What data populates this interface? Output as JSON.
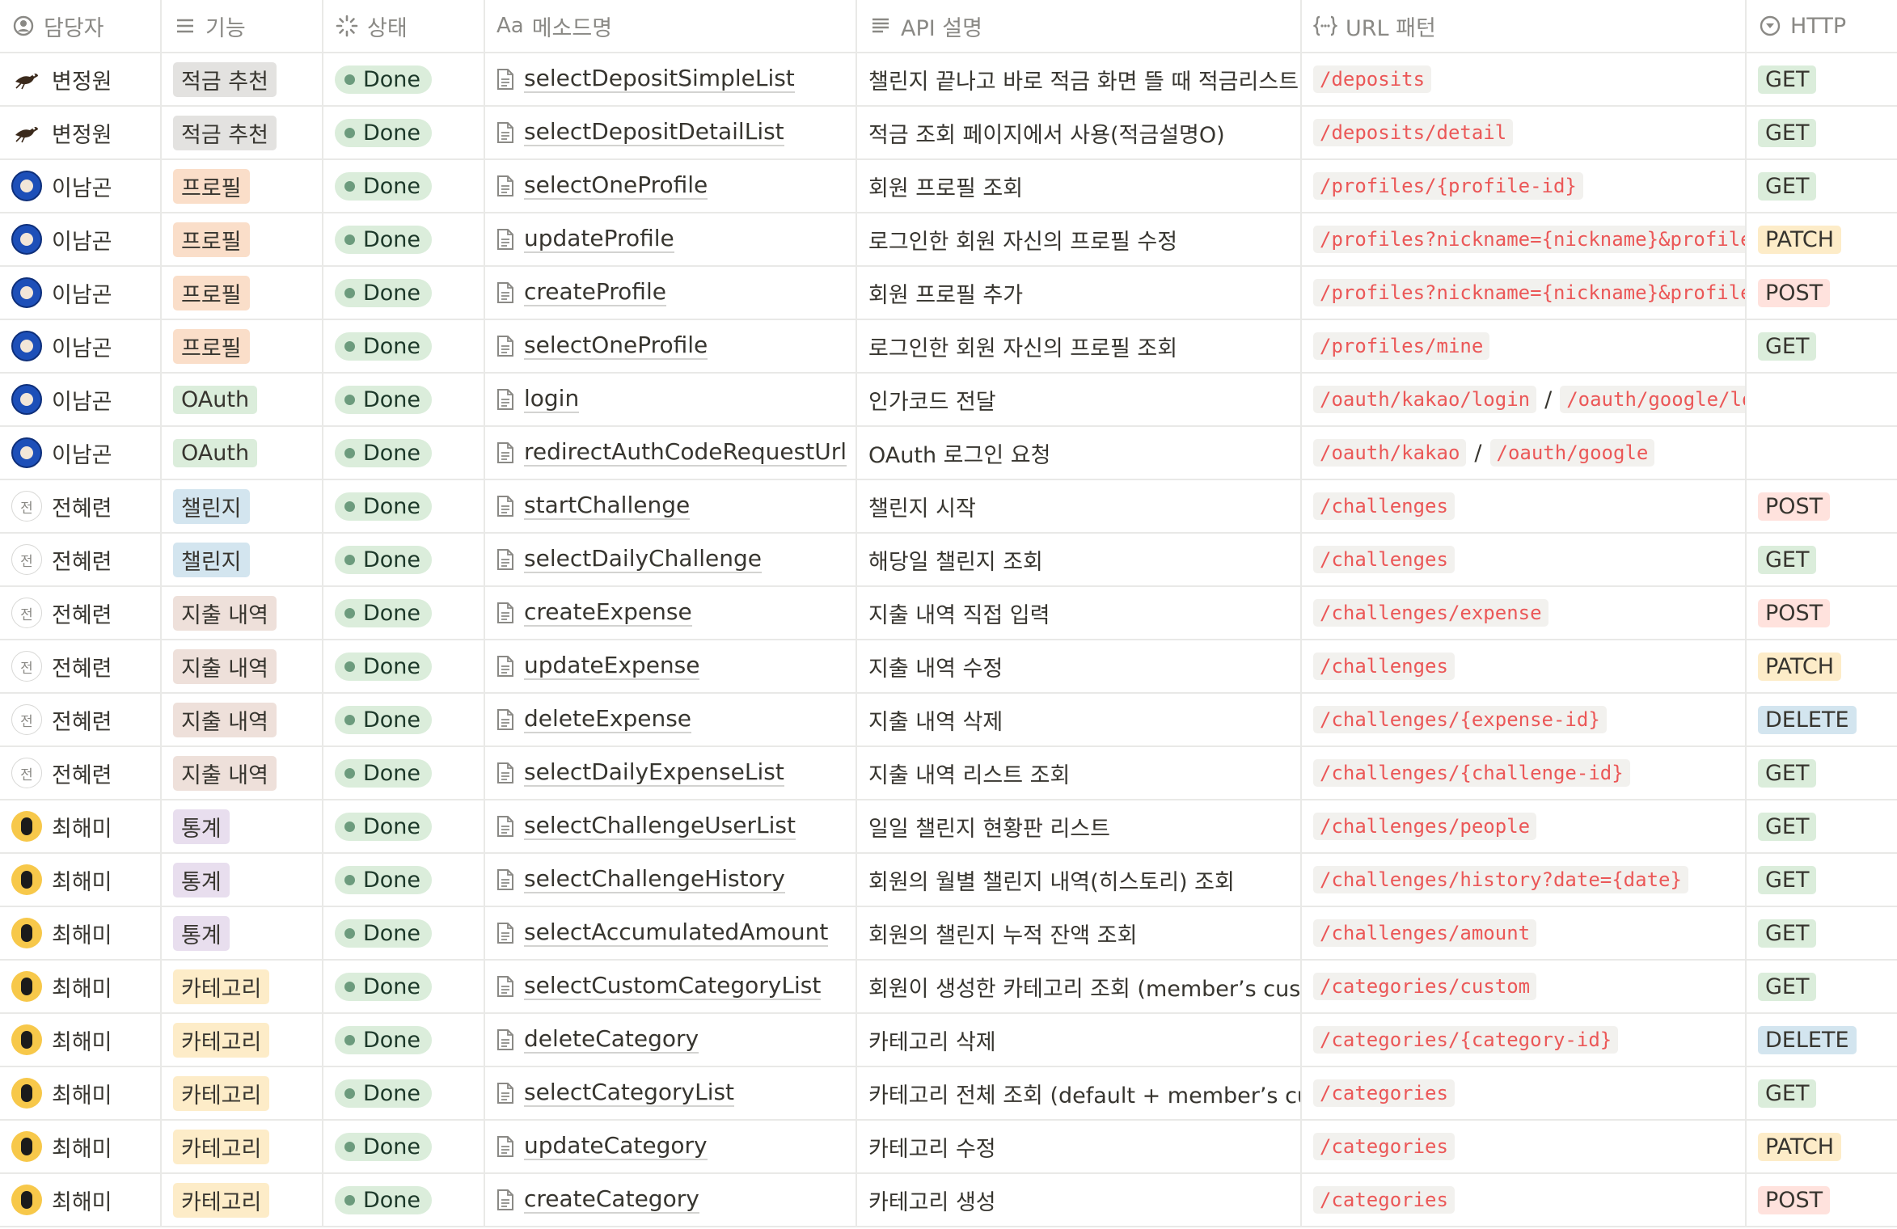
{
  "headers": [
    {
      "icon": "person-icon",
      "label": "담당자"
    },
    {
      "icon": "list-icon",
      "label": "기능"
    },
    {
      "icon": "loading-icon",
      "label": "상태"
    },
    {
      "icon": "text-icon",
      "label": "메소드명",
      "prefix": "Aa"
    },
    {
      "icon": "lines-icon",
      "label": "API 설명"
    },
    {
      "icon": "formula-icon",
      "label": "URL 패턴"
    },
    {
      "icon": "select-icon",
      "label": "HTTP"
    }
  ],
  "colors": {
    "tag_gray": "#e3e2e0",
    "tag_orange": "#fadec9",
    "tag_green": "#dbeddb",
    "tag_blue": "#d3e5ef",
    "tag_brown": "#eee0da",
    "tag_purple": "#e8deee",
    "tag_yellow": "#fdecc8",
    "http_get": "#dbeddb",
    "http_post": "#ffe2dd",
    "http_patch": "#fdecc8",
    "http_delete": "#d3e5ef",
    "url_text": "#eb5757"
  },
  "rows": [
    {
      "assignee": "변정원",
      "avatar": "bird",
      "feature": "적금 추천",
      "tag": "gray",
      "status": "Done",
      "method": "selectDepositSimpleList",
      "desc": "챌린지 끝나고 바로 적금 화면 뜰 때 적금리스트",
      "urls": [
        "/deposits"
      ],
      "http": "GET"
    },
    {
      "assignee": "변정원",
      "avatar": "bird",
      "feature": "적금 추천",
      "tag": "gray",
      "status": "Done",
      "method": "selectDepositDetailList",
      "desc": "적금 조회 페이지에서 사용(적금설명O)",
      "urls": [
        "/deposits/detail"
      ],
      "http": "GET"
    },
    {
      "assignee": "이남곤",
      "avatar": "blue",
      "feature": "프로필",
      "tag": "orange",
      "status": "Done",
      "method": "selectOneProfile",
      "desc": "회원 프로필 조회",
      "urls": [
        "/profiles/{profile-id}"
      ],
      "http": "GET"
    },
    {
      "assignee": "이남곤",
      "avatar": "blue",
      "feature": "프로필",
      "tag": "orange",
      "status": "Done",
      "method": "updateProfile",
      "desc": "로그인한 회원 자신의 프로필 수정",
      "urls": [
        "/profiles?nickname={nickname}&profile"
      ],
      "http": "PATCH"
    },
    {
      "assignee": "이남곤",
      "avatar": "blue",
      "feature": "프로필",
      "tag": "orange",
      "status": "Done",
      "method": "createProfile",
      "desc": "회원 프로필 추가",
      "urls": [
        "/profiles?nickname={nickname}&profile"
      ],
      "http": "POST"
    },
    {
      "assignee": "이남곤",
      "avatar": "blue",
      "feature": "프로필",
      "tag": "orange",
      "status": "Done",
      "method": "selectOneProfile",
      "desc": "로그인한 회원 자신의 프로필 조회",
      "urls": [
        "/profiles/mine"
      ],
      "http": "GET"
    },
    {
      "assignee": "이남곤",
      "avatar": "blue",
      "feature": "OAuth",
      "tag": "green",
      "status": "Done",
      "method": "login",
      "desc": "인가코드 전달",
      "urls": [
        "/oauth/kakao/login",
        "/oauth/google/lo"
      ],
      "http": ""
    },
    {
      "assignee": "이남곤",
      "avatar": "blue",
      "feature": "OAuth",
      "tag": "green",
      "status": "Done",
      "method": "redirectAuthCodeRequestUrl",
      "desc": "OAuth 로그인 요청",
      "urls": [
        "/oauth/kakao",
        "/oauth/google"
      ],
      "http": ""
    },
    {
      "assignee": "전혜련",
      "avatar": "전",
      "feature": "챌린지",
      "tag": "blue",
      "status": "Done",
      "method": "startChallenge",
      "desc": "챌린지 시작",
      "urls": [
        "/challenges"
      ],
      "http": "POST"
    },
    {
      "assignee": "전혜련",
      "avatar": "전",
      "feature": "챌린지",
      "tag": "blue",
      "status": "Done",
      "method": "selectDailyChallenge",
      "desc": "해당일 챌린지 조회",
      "urls": [
        "/challenges"
      ],
      "http": "GET"
    },
    {
      "assignee": "전혜련",
      "avatar": "전",
      "feature": "지출 내역",
      "tag": "brown",
      "status": "Done",
      "method": "createExpense",
      "desc": "지출 내역 직접 입력",
      "urls": [
        "/challenges/expense"
      ],
      "http": "POST"
    },
    {
      "assignee": "전혜련",
      "avatar": "전",
      "feature": "지출 내역",
      "tag": "brown",
      "status": "Done",
      "method": "updateExpense",
      "desc": "지출 내역 수정",
      "urls": [
        "/challenges"
      ],
      "http": "PATCH"
    },
    {
      "assignee": "전혜련",
      "avatar": "전",
      "feature": "지출 내역",
      "tag": "brown",
      "status": "Done",
      "method": "deleteExpense",
      "desc": "지출 내역 삭제",
      "urls": [
        "/challenges/{expense-id}"
      ],
      "http": "DELETE"
    },
    {
      "assignee": "전혜련",
      "avatar": "전",
      "feature": "지출 내역",
      "tag": "brown",
      "status": "Done",
      "method": "selectDailyExpenseList",
      "desc": "지출 내역 리스트 조회",
      "urls": [
        "/challenges/{challenge-id}"
      ],
      "http": "GET"
    },
    {
      "assignee": "최해미",
      "avatar": "yellow",
      "feature": "통계",
      "tag": "purple",
      "status": "Done",
      "method": "selectChallengeUserList",
      "desc": "일일 챌린지 현황판 리스트",
      "urls": [
        "/challenges/people"
      ],
      "http": "GET"
    },
    {
      "assignee": "최해미",
      "avatar": "yellow",
      "feature": "통계",
      "tag": "purple",
      "status": "Done",
      "method": "selectChallengeHistory",
      "desc": "회원의 월별 챌린지 내역(히스토리) 조회",
      "urls": [
        "/challenges/history?date={date}"
      ],
      "http": "GET"
    },
    {
      "assignee": "최해미",
      "avatar": "yellow",
      "feature": "통계",
      "tag": "purple",
      "status": "Done",
      "method": "selectAccumulatedAmount",
      "desc": "회원의 챌린지 누적 잔액 조회",
      "urls": [
        "/challenges/amount"
      ],
      "http": "GET"
    },
    {
      "assignee": "최해미",
      "avatar": "yellow",
      "feature": "카테고리",
      "tag": "yellow",
      "status": "Done",
      "method": "selectCustomCategoryList",
      "desc": "회원이 생성한 카테고리 조회 (member’s custo",
      "urls": [
        "/categories/custom"
      ],
      "http": "GET"
    },
    {
      "assignee": "최해미",
      "avatar": "yellow",
      "feature": "카테고리",
      "tag": "yellow",
      "status": "Done",
      "method": "deleteCategory",
      "desc": "카테고리 삭제",
      "urls": [
        "/categories/{category-id}"
      ],
      "http": "DELETE"
    },
    {
      "assignee": "최해미",
      "avatar": "yellow",
      "feature": "카테고리",
      "tag": "yellow",
      "status": "Done",
      "method": "selectCategoryList",
      "desc": "카테고리 전체 조회 (default + member’s cus",
      "urls": [
        "/categories"
      ],
      "http": "GET"
    },
    {
      "assignee": "최해미",
      "avatar": "yellow",
      "feature": "카테고리",
      "tag": "yellow",
      "status": "Done",
      "method": "updateCategory",
      "desc": "카테고리 수정",
      "urls": [
        "/categories"
      ],
      "http": "PATCH"
    },
    {
      "assignee": "최해미",
      "avatar": "yellow",
      "feature": "카테고리",
      "tag": "yellow",
      "status": "Done",
      "method": "createCategory",
      "desc": "카테고리 생성",
      "urls": [
        "/categories"
      ],
      "http": "POST"
    }
  ]
}
